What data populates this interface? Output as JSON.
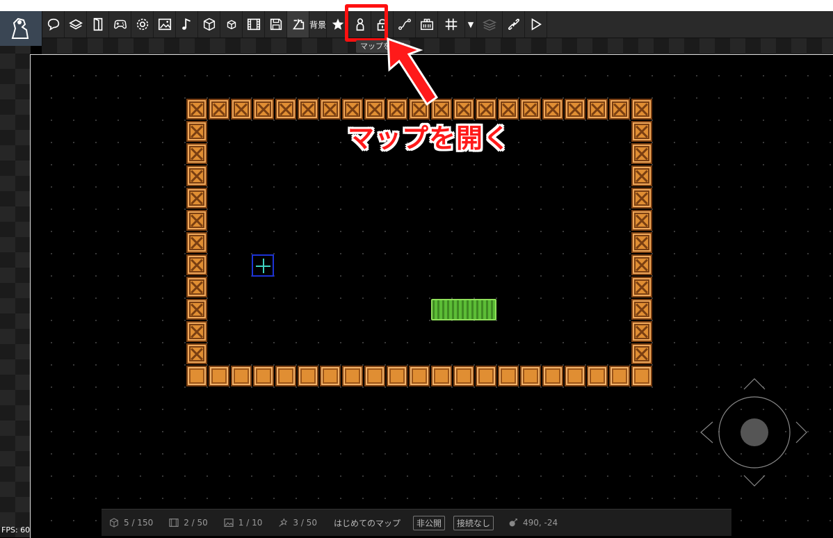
{
  "toolbar": {
    "tools": [
      {
        "icon": "speech-bubble-icon"
      },
      {
        "icon": "layers-icon"
      },
      {
        "icon": "door-icon"
      },
      {
        "icon": "gamepad-icon"
      },
      {
        "icon": "gear-icon"
      },
      {
        "icon": "image-icon"
      },
      {
        "icon": "music-note-icon"
      },
      {
        "icon": "cube-icon"
      },
      {
        "icon": "small-cube-icon"
      },
      {
        "icon": "film-icon"
      },
      {
        "icon": "save-icon"
      },
      {
        "icon": "open-map-icon"
      },
      {
        "icon": "star-icon"
      },
      {
        "icon": "person-icon"
      },
      {
        "icon": "lock-icon"
      },
      {
        "icon": "path-icon"
      },
      {
        "icon": "database-icon"
      },
      {
        "icon": "grid-icon"
      },
      {
        "icon": "stack-icon"
      },
      {
        "icon": "link-icon"
      },
      {
        "icon": "play-icon"
      }
    ],
    "background_label": "背景",
    "tooltip": "マップを開く"
  },
  "annotation": {
    "text": "マップを開く",
    "color": "#ff1a1a"
  },
  "status": {
    "objects": "5 / 150",
    "scenes": "2 / 50",
    "images": "1 / 10",
    "effects": "3 / 50",
    "map_name": "はじめてのマップ",
    "visibility": "非公開",
    "connection": "接続なし",
    "coordinates": "490, -24"
  },
  "fps": "FPS: 60",
  "colors": {
    "toolbar_bg": "#2a2a2a",
    "crate": "#e08e33",
    "grass": "#4fa62c",
    "highlight": "#ff1010"
  }
}
